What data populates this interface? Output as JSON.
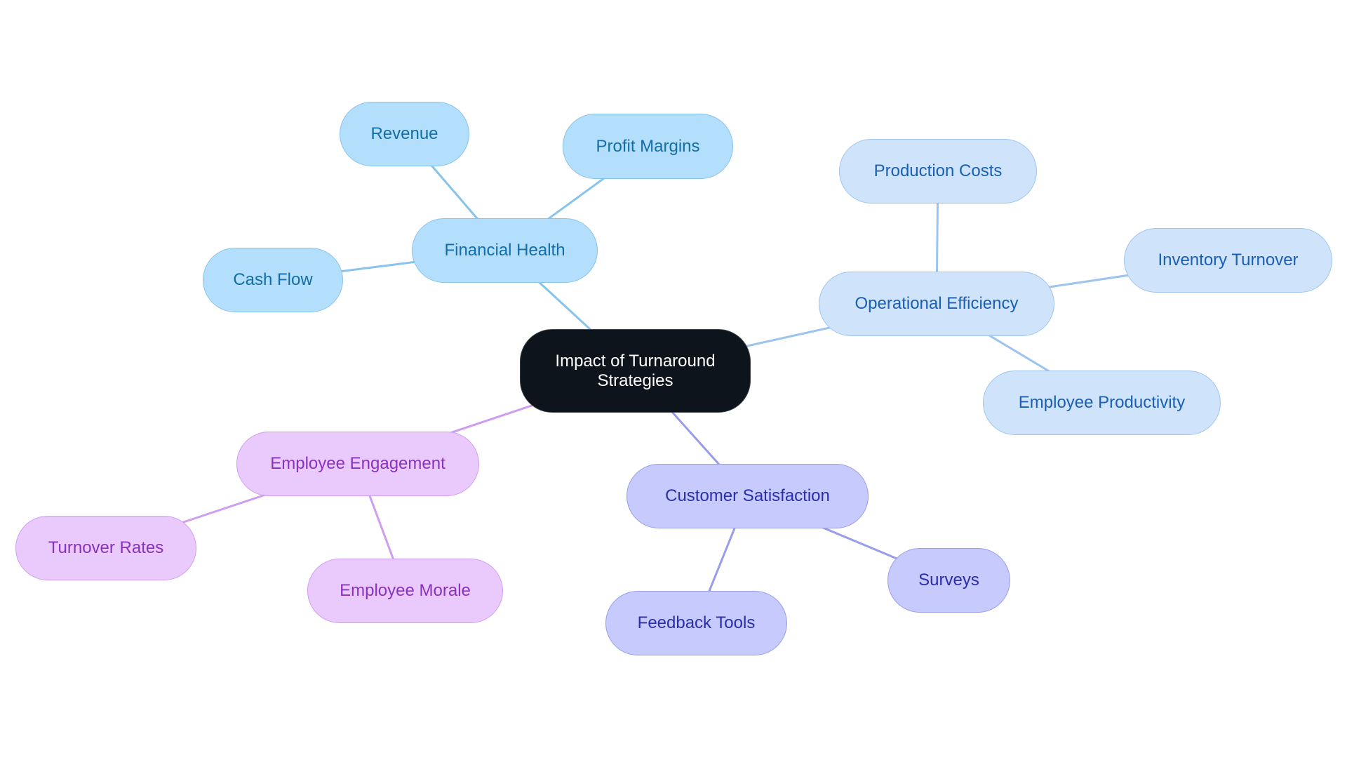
{
  "diagram": {
    "type": "mindmap",
    "root": {
      "id": "root",
      "label": "Impact of Turnaround\nStrategies",
      "color": "#0d141c"
    },
    "branches": [
      {
        "id": "financial-health",
        "label": "Financial Health",
        "theme": "fin",
        "edge_color": "#88c3ec",
        "children": [
          {
            "id": "revenue",
            "label": "Revenue"
          },
          {
            "id": "profit-margins",
            "label": "Profit Margins"
          },
          {
            "id": "cash-flow",
            "label": "Cash Flow"
          }
        ]
      },
      {
        "id": "operational-efficiency",
        "label": "Operational Efficiency",
        "theme": "ops",
        "edge_color": "#9cc4ee",
        "children": [
          {
            "id": "production-costs",
            "label": "Production Costs"
          },
          {
            "id": "inventory-turnover",
            "label": "Inventory Turnover"
          },
          {
            "id": "employee-productivity",
            "label": "Employee Productivity"
          }
        ]
      },
      {
        "id": "customer-satisfaction",
        "label": "Customer Satisfaction",
        "theme": "cus",
        "edge_color": "#989de8",
        "children": [
          {
            "id": "surveys",
            "label": "Surveys"
          },
          {
            "id": "feedback-tools",
            "label": "Feedback Tools"
          }
        ]
      },
      {
        "id": "employee-engagement",
        "label": "Employee Engagement",
        "theme": "eng",
        "edge_color": "#cf9ef0",
        "children": [
          {
            "id": "turnover-rates",
            "label": "Turnover Rates"
          },
          {
            "id": "employee-morale",
            "label": "Employee Morale"
          }
        ]
      }
    ]
  }
}
